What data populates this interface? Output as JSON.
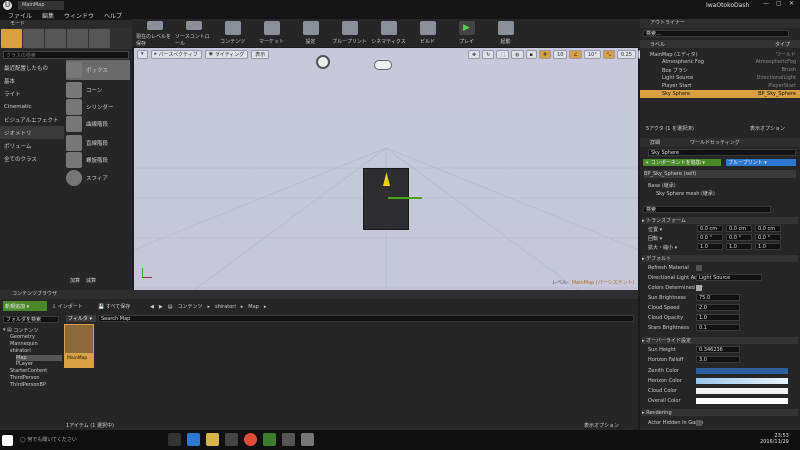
{
  "window": {
    "tab_title": "MainMap",
    "project_name": "IwaOtokoDash",
    "menus": [
      "ファイル",
      "編集",
      "ウィンドウ",
      "ヘルプ"
    ]
  },
  "modes_tab": "モード",
  "placement": {
    "search_placeholder": "クラスの検索",
    "categories": [
      "最近配置したもの",
      "基本",
      "ライト",
      "Cinematic",
      "ビジュアルエフェクト",
      "ジオメトリ",
      "ボリューム",
      "全てのクラス"
    ],
    "selected_category": "ジオメトリ",
    "items": [
      "ボックス",
      "コーン",
      "シリンダー",
      "曲線階段",
      "直線階段",
      "螺旋階段",
      "スフィア"
    ],
    "footer": [
      "加算",
      "減算"
    ]
  },
  "toolbar": [
    "現在のレベルを保存",
    "ソースコントロール",
    "コンテンツ",
    "マーケット",
    "設定",
    "ブループリント",
    "シネマティクス",
    "ビルド",
    "プレイ",
    "起動"
  ],
  "viewport": {
    "perspective": "パースペクティブ",
    "lighting": "ライティング",
    "show": "表示",
    "grid_snap": "10",
    "rot_snap": "10°",
    "scale_snap": "0.25",
    "cam_speed": "4",
    "level_label": "レベル:",
    "level_name": "MainMap (パーシステント)"
  },
  "outliner": {
    "tab": "アウトライナー",
    "search_placeholder": "検索...",
    "col_label": "ラベル",
    "col_type": "タイプ",
    "rows": [
      {
        "label": "MainMap (エディタ)",
        "type": "ワールド"
      },
      {
        "label": "Atmospheric Fog",
        "type": "AtmosphericFog"
      },
      {
        "label": "Box ブラシ",
        "type": "Brush"
      },
      {
        "label": "Light Source",
        "type": "DirectionalLight"
      },
      {
        "label": "Player Start",
        "type": "PlayerStart"
      },
      {
        "label": "Sky Sphere",
        "type": "BP_Sky_Sphere"
      }
    ],
    "count": "5アクタ (1 を選択済)",
    "view_options": "表示オプション"
  },
  "details": {
    "tab1": "詳細",
    "tab2": "ワールドセッティング",
    "name": "Sky Sphere",
    "add_component": "+ コンポーネントを追加 ▾",
    "blueprint": "ブループリント ▾",
    "self": "BP_Sky_Sphere (self)",
    "base": "Base (継承)",
    "mesh": "Sky Sphere mesh (継承)",
    "search_placeholder": "検索",
    "transform": "トランスフォーム",
    "location": "位置 ▾",
    "rotation": "回転 ▾",
    "scale": "拡大・縮小 ▾",
    "loc_vals": [
      "0.0 cm",
      "0.0 cm",
      "0.0 cm"
    ],
    "rot_vals": [
      "0.0 °",
      "0.0 °",
      "0.0 °"
    ],
    "scale_vals": [
      "1.0",
      "1.0",
      "1.0"
    ],
    "default": "デフォルト",
    "props": [
      {
        "name": "Refresh Material",
        "value": ""
      },
      {
        "name": "Directional Light Actor",
        "value": "Light Source"
      },
      {
        "name": "Colors Determined By",
        "value": ""
      },
      {
        "name": "Sun Brightness",
        "value": "75.0"
      },
      {
        "name": "Cloud Speed",
        "value": "2.0"
      },
      {
        "name": "Cloud Opacity",
        "value": "1.0"
      },
      {
        "name": "Stars Brightness",
        "value": "0.1"
      }
    ],
    "override": "オーバーライド設定",
    "override_props": [
      {
        "name": "Sun Height",
        "value": "0.346236"
      },
      {
        "name": "Horizon Falloff",
        "value": "3.0"
      },
      {
        "name": "Zenith Color",
        "value": ""
      },
      {
        "name": "Horizon Color",
        "value": ""
      },
      {
        "name": "Cloud Color",
        "value": ""
      },
      {
        "name": "Overall Color",
        "value": ""
      }
    ],
    "rendering": "Rendering",
    "hidden": "Actor Hidden In Game"
  },
  "content": {
    "tab": "コンテンツブラウザ",
    "add_new": "新規追加 ▾",
    "import": "インポート",
    "save_all": "すべて保存",
    "path": [
      "コンテンツ",
      "shiratori",
      "Map"
    ],
    "folder_search": "フォルダを検索",
    "filter": "フィルタ ▾",
    "search_placeholder": "Search Map",
    "tree": [
      "コンテンツ",
      "Geometry",
      "Mannequin",
      "shiratori",
      "Map",
      "PLayer",
      "StarterContent",
      "ThirdPerson",
      "ThirdPersonBP"
    ],
    "asset": "MainMap",
    "status": "1アイテム (1 選択中)",
    "view_options": "表示オプション"
  },
  "taskbar": {
    "search": "何でも聞いてください",
    "time": "23:53",
    "date": "2016/11/29"
  },
  "colors": {
    "accent": "#d8a041",
    "green": "#5aa33a",
    "blue": "#2f78d0"
  }
}
